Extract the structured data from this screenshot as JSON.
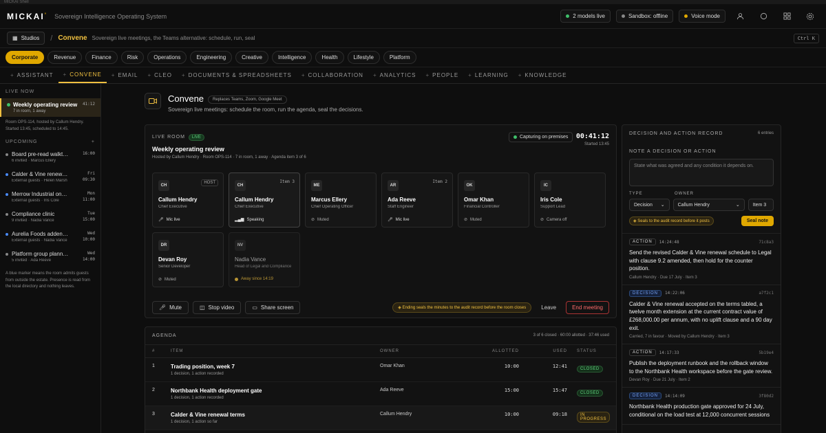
{
  "app": {
    "window_title": "MICKAI Shell",
    "brand": "MICKAI",
    "brand_mark": "°",
    "tagline": "Sovereign Intelligence Operating System",
    "status_pills": [
      {
        "label": "2 models live",
        "color": "#3fbf6a"
      },
      {
        "label": "Sandbox: offline",
        "color": "#888888"
      },
      {
        "label": "Voice mode",
        "color": "#e0a800"
      }
    ],
    "top_icons": [
      "user-icon",
      "circle-icon",
      "grid-icon",
      "gear-icon"
    ]
  },
  "studio": {
    "button_label": "Studios",
    "sep": "/",
    "title": "Convene",
    "subtitle": "Sovereign live meetings, the Teams alternative: schedule, run, seal",
    "shortcut": "Ctrl K"
  },
  "categories": [
    "Corporate",
    "Revenue",
    "Finance",
    "Risk",
    "Operations",
    "Engineering",
    "Creative",
    "Intelligence",
    "Health",
    "Lifestyle",
    "Platform"
  ],
  "tabs": [
    "ASSISTANT",
    "CONVENE",
    "EMAIL",
    "CLEO",
    "DOCUMENTS & SPREADSHEETS",
    "COLLABORATION",
    "ANALYTICS",
    "PEOPLE",
    "LEARNING",
    "KNOWLEDGE"
  ],
  "sidebar": {
    "live_heading": "LIVE NOW",
    "live_item": {
      "title": "Weekly operating review",
      "sub": "7 in room, 1 away",
      "time": "41:12"
    },
    "live_note": "Room OPS-114, hosted by Callum Hendry. Started 13:45, scheduled to 14:45.",
    "upcoming_heading": "UPCOMING",
    "upcoming_add": "+",
    "upcoming": [
      {
        "title": "Board pre-read walkthrough",
        "sub": "6 invited · Marcus Ellery",
        "day": "",
        "time": "16:00",
        "color": "#888888"
      },
      {
        "title": "Calder & Vine renewal review",
        "sub": "External guests · Helen Marsh",
        "day": "Fri",
        "time": "09:30",
        "color": "#4a8cff"
      },
      {
        "title": "Merrow Industrial onboarding",
        "sub": "External guests · Iris Cole",
        "day": "Mon",
        "time": "11:00",
        "color": "#4a8cff"
      },
      {
        "title": "Compliance clinic",
        "sub": "9 invited · Nadia Vance",
        "day": "Tue",
        "time": "15:00",
        "color": "#888888"
      },
      {
        "title": "Aurelia Foods addendum",
        "sub": "External guests · Nadia Vance",
        "day": "Wed",
        "time": "10:00",
        "color": "#4a8cff"
      },
      {
        "title": "Platform group planning",
        "sub": "5 invited · Ada Reeve",
        "day": "Wed",
        "time": "14:00",
        "color": "#888888"
      }
    ],
    "footer_note": "A blue marker means the room admits guests from outside the estate. Presence is read from the local directory and nothing leaves."
  },
  "page": {
    "title": "Convene",
    "replaces": "Replaces Teams, Zoom, Google Meet",
    "subtitle": "Sovereign live meetings: schedule the room, run the agenda, seal the decisions."
  },
  "room": {
    "label": "LIVE ROOM",
    "badge": "LIVE",
    "title": "Weekly operating review",
    "meta": "Hosted by Callum Hendry · Room OPS-114 · 7 in room, 1 away · Agenda item 3 of 6",
    "capture": "Capturing on premises",
    "clock": "00:41:12",
    "started": "Started 13:45",
    "participants": [
      {
        "initials": "CH",
        "tag": "HOST",
        "name": "Callum Hendry",
        "role": "Chief Executive",
        "status": "Mic live",
        "icon": "mic-icon",
        "state": "active"
      },
      {
        "initials": "CH",
        "tag": "Item 3",
        "name": "Callum Hendry",
        "role": "Chief Executive",
        "status": "Speaking",
        "icon": "speaking-icon",
        "state": "speaking"
      },
      {
        "initials": "ME",
        "tag": "",
        "name": "Marcus Ellery",
        "role": "Chief Operating Officer",
        "status": "Muted",
        "icon": "muted-icon",
        "state": "muted"
      },
      {
        "initials": "AR",
        "tag": "Item 2",
        "name": "Ada Reeve",
        "role": "Staff Engineer",
        "status": "Mic live",
        "icon": "mic-icon",
        "state": "active"
      },
      {
        "initials": "OK",
        "tag": "",
        "name": "Omar Khan",
        "role": "Financial Controller",
        "status": "Muted",
        "icon": "muted-icon",
        "state": "muted"
      },
      {
        "initials": "IC",
        "tag": "",
        "name": "Iris Cole",
        "role": "Support Lead",
        "status": "Camera off",
        "icon": "camera-off-icon",
        "state": "muted"
      },
      {
        "initials": "DR",
        "tag": "",
        "name": "Devan Roy",
        "role": "Senior Developer",
        "status": "Muted",
        "icon": "muted-icon",
        "state": "muted"
      },
      {
        "initials": "NV",
        "tag": "",
        "name": "Nadia Vance",
        "role": "Head of Legal and Compliance",
        "status": "Away since 14:19",
        "icon": "dot-icon",
        "state": "away"
      }
    ],
    "controls": {
      "mute": "Mute",
      "stop_video": "Stop video",
      "share": "Share screen"
    },
    "seal_warning": "Ending seals the minutes to the audit record before the room closes",
    "leave": "Leave",
    "end": "End meeting"
  },
  "agenda": {
    "label": "AGENDA",
    "summary": "3 of 6 closed · 60:00 allotted · 37:46 used",
    "columns": [
      "#",
      "ITEM",
      "OWNER",
      "ALLOTTED",
      "USED",
      "STATUS"
    ],
    "rows": [
      {
        "num": "1",
        "item": "Trading position, week 7",
        "sub": "1 decision, 1 action recorded",
        "owner": "Omar Khan",
        "allotted": "10:00",
        "used": "12:41",
        "status": "CLOSED",
        "state": "closed"
      },
      {
        "num": "2",
        "item": "Northbank Health deployment gate",
        "sub": "1 decision, 1 action recorded",
        "owner": "Ada Reeve",
        "allotted": "15:00",
        "used": "15:47",
        "status": "CLOSED",
        "state": "closed"
      },
      {
        "num": "3",
        "item": "Calder & Vine renewal terms",
        "sub": "1 decision, 1 action so far",
        "owner": "Callum Hendry",
        "allotted": "10:00",
        "used": "09:18",
        "status": "IN PROGRESS",
        "state": "progress"
      }
    ]
  },
  "record": {
    "label": "DECISION AND ACTION RECORD",
    "count": "6 entries",
    "note_label": "NOTE A DECISION OR ACTION",
    "placeholder": "State what was agreed and any condition it depends on.",
    "type_label": "TYPE",
    "owner_label": "OWNER",
    "type_value": "Decision",
    "owner_value": "Callum Hendry",
    "item_value": "Item 3",
    "seal_hint": "Seals to the audit record before it posts",
    "seal_button": "Seal note",
    "entries": [
      {
        "type": "ACTION",
        "time": "14:24:48",
        "hash": "71c8a3",
        "text": "Send the revised Calder & Vine renewal schedule to Legal with clause 9.2 amended, then hold for the counter position.",
        "meta": "Callum Hendry · Due 17 July · Item 3"
      },
      {
        "type": "DECISION",
        "time": "14:22:06",
        "hash": "a7f2c1",
        "text": "Calder & Vine renewal accepted on the terms tabled, a twelve month extension at the current contract value of £268,000.00 per annum, with no uplift clause and a 90 day exit.",
        "meta": "Carried, 7 in favour · Moved by Callum Hendry · Item 3"
      },
      {
        "type": "ACTION",
        "time": "14:17:33",
        "hash": "5b19e4",
        "text": "Publish the deployment runbook and the rollback window to the Northbank Health workspace before the gate review.",
        "meta": "Devan Roy · Due 21 July · Item 2"
      },
      {
        "type": "DECISION",
        "time": "14:14:09",
        "hash": "3f80d2",
        "text": "Northbank Health production gate approved for 24 July, conditional on the load test at 12,000 concurrent sessions",
        "meta": ""
      }
    ]
  }
}
